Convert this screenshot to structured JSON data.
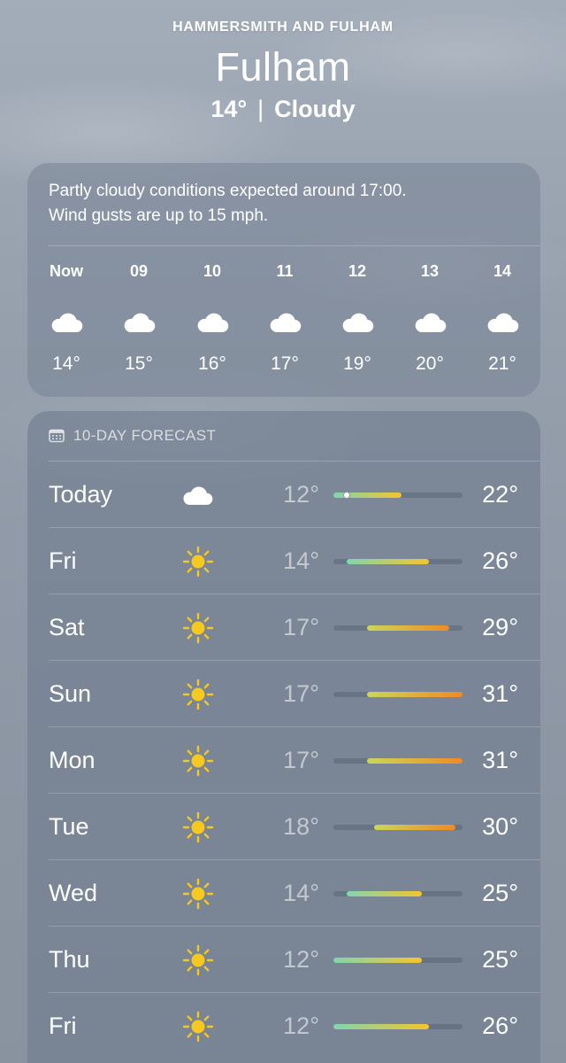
{
  "header": {
    "region": "HAMMERSMITH AND FULHAM",
    "city": "Fulham",
    "current_temp": "14°",
    "separator": "|",
    "condition": "Cloudy"
  },
  "hourly": {
    "summary_line1": "Partly cloudy conditions expected around 17:00.",
    "summary_line2": "Wind gusts are up to 15 mph.",
    "hours": [
      {
        "time": "Now",
        "icon": "cloud-icon",
        "temp": "14°"
      },
      {
        "time": "09",
        "icon": "cloud-icon",
        "temp": "15°"
      },
      {
        "time": "10",
        "icon": "cloud-icon",
        "temp": "16°"
      },
      {
        "time": "11",
        "icon": "cloud-icon",
        "temp": "17°"
      },
      {
        "time": "12",
        "icon": "cloud-icon",
        "temp": "19°"
      },
      {
        "time": "13",
        "icon": "cloud-icon",
        "temp": "20°"
      },
      {
        "time": "14",
        "icon": "cloud-icon",
        "temp": "21°"
      }
    ]
  },
  "forecast": {
    "title": "10-DAY FORECAST",
    "range_min": 12,
    "range_max": 31,
    "current_temp_value": 14,
    "days": [
      {
        "day": "Today",
        "icon": "cloud-icon",
        "low": "12°",
        "high": "22°",
        "low_v": 12,
        "high_v": 22
      },
      {
        "day": "Fri",
        "icon": "sun-icon",
        "low": "14°",
        "high": "26°",
        "low_v": 14,
        "high_v": 26
      },
      {
        "day": "Sat",
        "icon": "sun-icon",
        "low": "17°",
        "high": "29°",
        "low_v": 17,
        "high_v": 29
      },
      {
        "day": "Sun",
        "icon": "sun-icon",
        "low": "17°",
        "high": "31°",
        "low_v": 17,
        "high_v": 31
      },
      {
        "day": "Mon",
        "icon": "sun-icon",
        "low": "17°",
        "high": "31°",
        "low_v": 17,
        "high_v": 31
      },
      {
        "day": "Tue",
        "icon": "sun-icon",
        "low": "18°",
        "high": "30°",
        "low_v": 18,
        "high_v": 30
      },
      {
        "day": "Wed",
        "icon": "sun-icon",
        "low": "14°",
        "high": "25°",
        "low_v": 14,
        "high_v": 25
      },
      {
        "day": "Thu",
        "icon": "sun-icon",
        "low": "12°",
        "high": "25°",
        "low_v": 12,
        "high_v": 25
      },
      {
        "day": "Fri",
        "icon": "sun-icon",
        "low": "12°",
        "high": "26°",
        "low_v": 12,
        "high_v": 26
      }
    ]
  },
  "colors": {
    "sun": "#f7c81e",
    "bar_cool": "#7fd6b0",
    "bar_mild": "#c9d75a",
    "bar_warm": "#f5c52a",
    "bar_hot": "#f08a24"
  }
}
